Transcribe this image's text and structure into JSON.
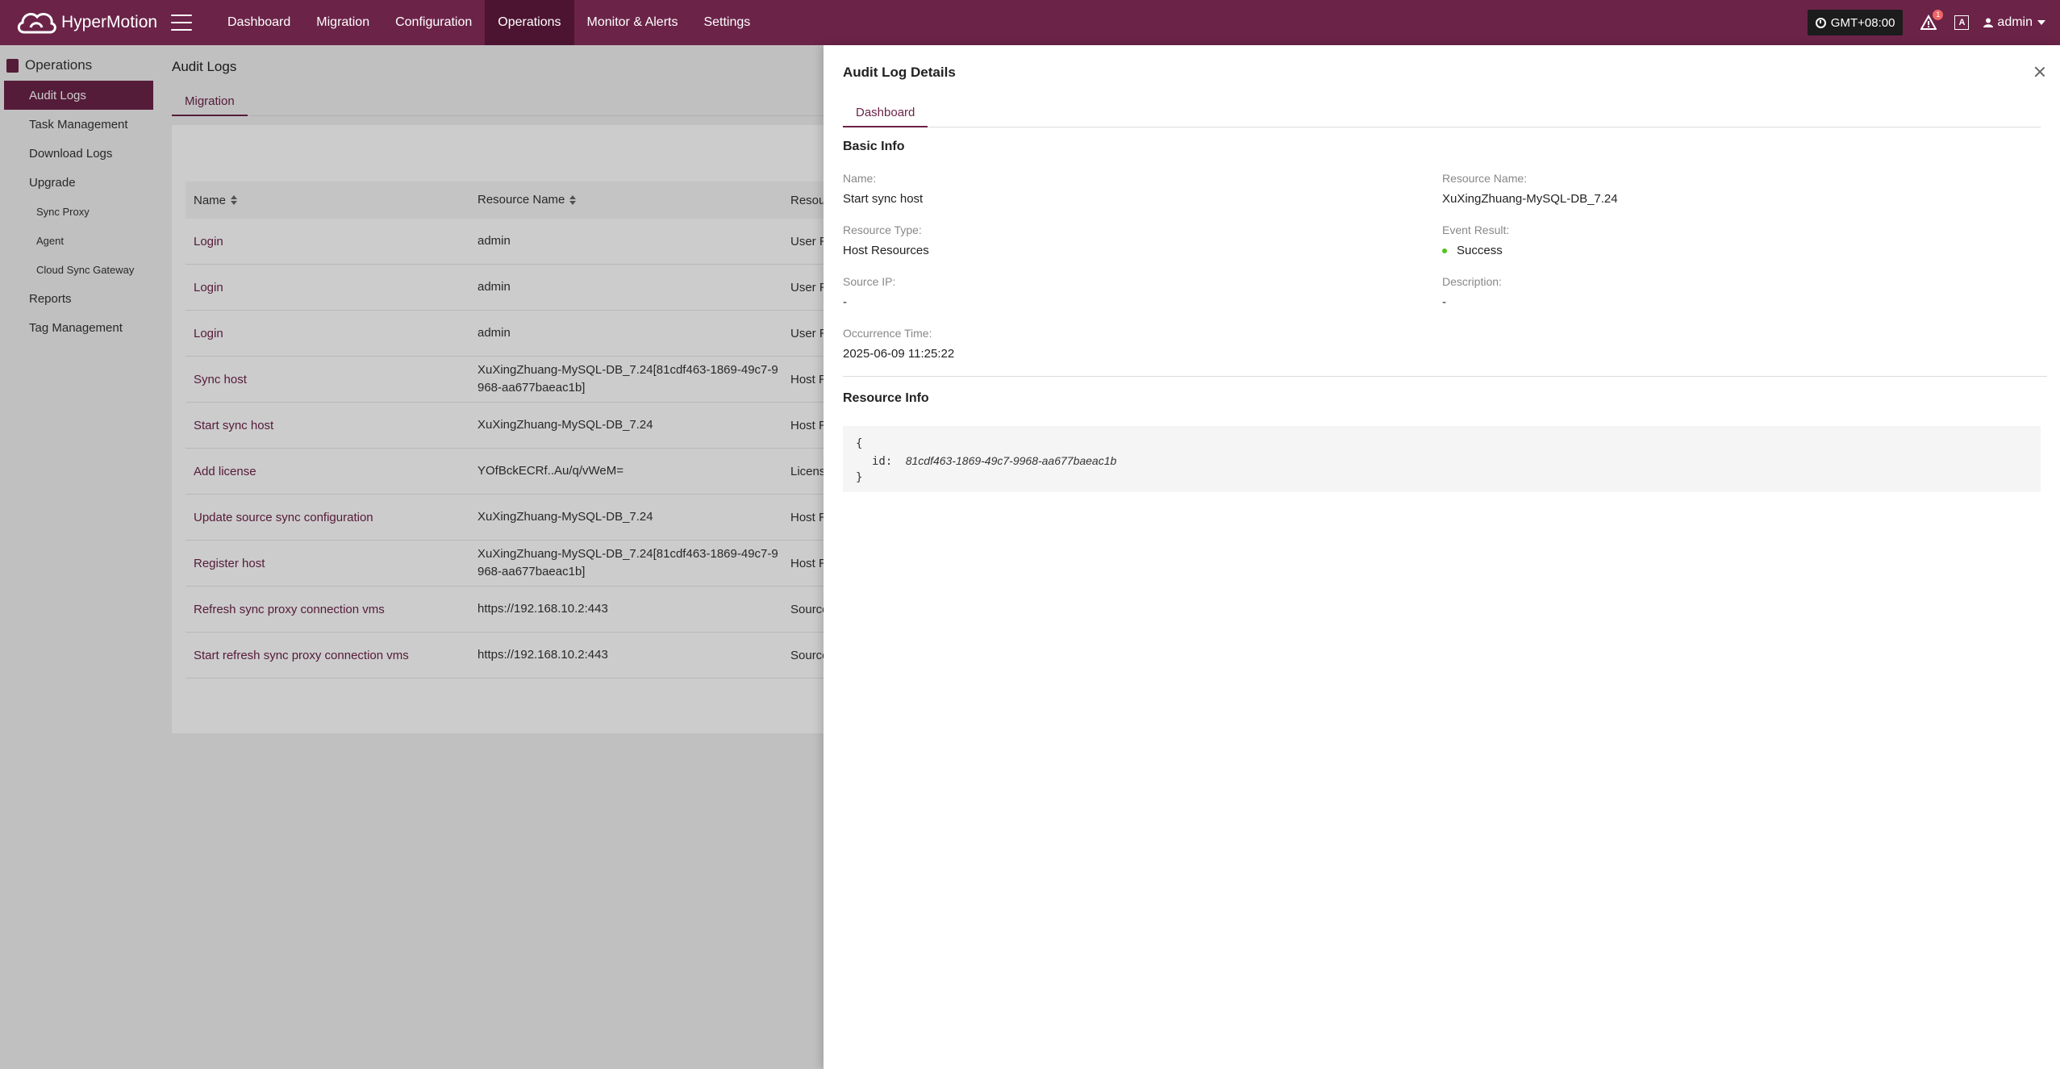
{
  "app": {
    "name": "HyperMotion"
  },
  "nav": {
    "items": [
      {
        "label": "Dashboard",
        "active": false
      },
      {
        "label": "Migration",
        "active": false
      },
      {
        "label": "Configuration",
        "active": false
      },
      {
        "label": "Operations",
        "active": true
      },
      {
        "label": "Monitor & Alerts",
        "active": false
      },
      {
        "label": "Settings",
        "active": false
      }
    ]
  },
  "topRight": {
    "timezone": "GMT+08:00",
    "alertCount": "1",
    "langIcon": "A",
    "user": "admin"
  },
  "sidebar": {
    "title": "Operations",
    "items": [
      {
        "label": "Audit Logs"
      },
      {
        "label": "Task Management"
      },
      {
        "label": "Download Logs"
      },
      {
        "label": "Upgrade"
      },
      {
        "label": "Sync Proxy"
      },
      {
        "label": "Agent"
      },
      {
        "label": "Cloud Sync Gateway"
      },
      {
        "label": "Reports"
      },
      {
        "label": "Tag Management"
      }
    ]
  },
  "page": {
    "title": "Audit Logs",
    "tab": "Migration",
    "table": {
      "columns": [
        "Name",
        "Resource Name",
        "Resou"
      ],
      "rows": [
        {
          "name": "Login",
          "resource": "admin",
          "type": "User R"
        },
        {
          "name": "Login",
          "resource": "admin",
          "type": "User R"
        },
        {
          "name": "Login",
          "resource": "admin",
          "type": "User R"
        },
        {
          "name": "Sync host",
          "resource": "XuXingZhuang-MySQL-DB_7.24[81cdf463-1869-49c7-9968-aa677baeac1b]",
          "type": "Host R"
        },
        {
          "name": "Start sync host",
          "resource": "XuXingZhuang-MySQL-DB_7.24",
          "type": "Host R"
        },
        {
          "name": "Add license",
          "resource": "YOfBckECRf..Au/q/vWeM=",
          "type": "Licens"
        },
        {
          "name": "Update source sync configuration",
          "resource": "XuXingZhuang-MySQL-DB_7.24",
          "type": "Host R"
        },
        {
          "name": "Register host",
          "resource": "XuXingZhuang-MySQL-DB_7.24[81cdf463-1869-49c7-9968-aa677baeac1b]",
          "type": "Host R"
        },
        {
          "name": "Refresh sync proxy connection vms",
          "resource": "https://192.168.10.2:443",
          "type": "Source"
        },
        {
          "name": "Start refresh sync proxy connection vms",
          "resource": "https://192.168.10.2:443",
          "type": "Source"
        }
      ]
    }
  },
  "drawer": {
    "title": "Audit Log Details",
    "tab": "Dashboard",
    "basicInfo": {
      "title": "Basic Info",
      "nameLabel": "Name:",
      "nameValue": "Start sync host",
      "resourceNameLabel": "Resource Name:",
      "resourceNameValue": "XuXingZhuang-MySQL-DB_7.24",
      "resourceTypeLabel": "Resource Type:",
      "resourceTypeValue": "Host Resources",
      "eventResultLabel": "Event Result:",
      "eventResultValue": "Success",
      "sourceIpLabel": "Source IP:",
      "sourceIpValue": "-",
      "descriptionLabel": "Description:",
      "descriptionValue": "-",
      "occurrenceTimeLabel": "Occurrence Time:",
      "occurrenceTimeValue": "2025-06-09 11:25:22"
    },
    "resourceInfo": {
      "title": "Resource Info",
      "open": "{",
      "key": "id:",
      "value": "81cdf463-1869-49c7-9968-aa677baeac1b",
      "close": "}"
    }
  },
  "colors": {
    "brand": "#6b2348",
    "brandDark": "#4c1431",
    "success": "#52c41a"
  }
}
